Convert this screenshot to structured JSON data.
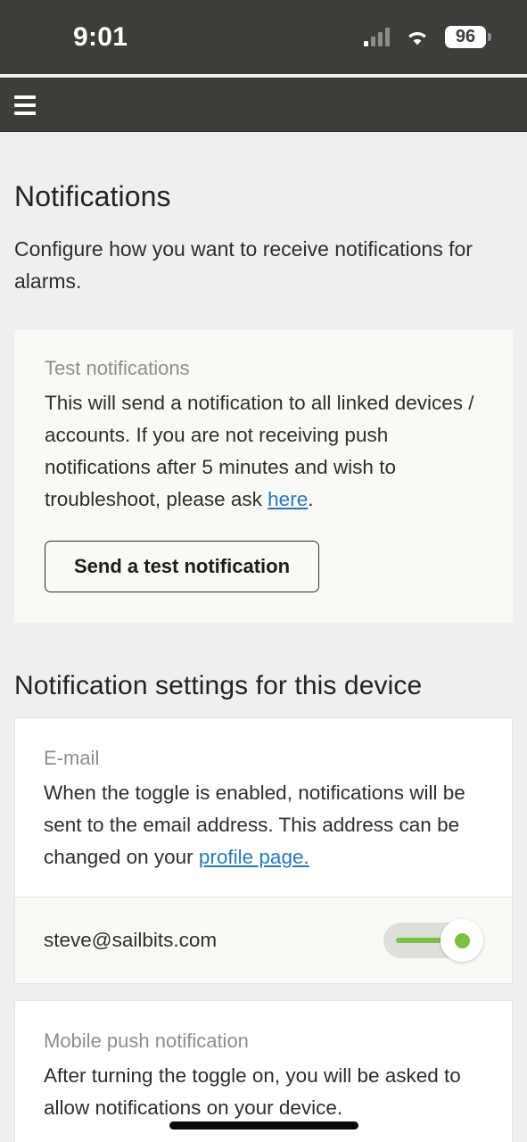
{
  "status_bar": {
    "time": "9:01",
    "battery_level": "96",
    "signal_icon": "cellular-signal-icon",
    "wifi_icon": "wifi-icon",
    "battery_icon": "battery-icon",
    "background_color": "#3d3d39"
  },
  "app_bar": {
    "menu_icon": "hamburger-menu-icon",
    "background_color": "#3d3d39"
  },
  "page": {
    "title": "Notifications",
    "subtitle": "Configure how you want to receive notifications for alarms."
  },
  "test_card": {
    "label": "Test notifications",
    "body_part1": "This will send a notification to all linked devices / accounts. If you are not receiving push notifications after 5 minutes and wish to troubleshoot, please ask ",
    "link_text": "here",
    "body_part2": ".",
    "button_label": "Send a test notification"
  },
  "device_section": {
    "title": "Notification settings for this device"
  },
  "email_card": {
    "label": "E-mail",
    "body_part1": "When the toggle is enabled, notifications will be sent to the email address. This address can be changed on your ",
    "link_text": "profile page.",
    "value": "steve@sailbits.com",
    "toggle_state": "on",
    "toggle_accent_color": "#7ac143"
  },
  "push_card": {
    "label": "Mobile push notification",
    "body": "After turning the toggle on, you will be asked to allow notifications on your device."
  },
  "colors": {
    "page_background": "#efefed",
    "card_background": "#f9f9f6",
    "link": "#2a7ab5",
    "muted_text": "#8e8e8a"
  }
}
